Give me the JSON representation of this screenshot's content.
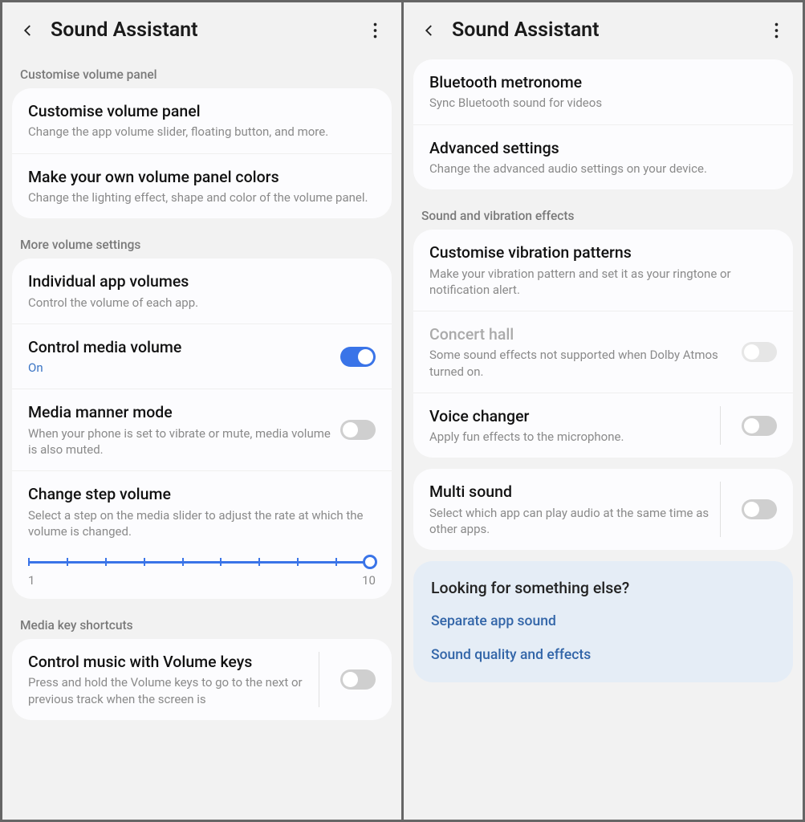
{
  "left": {
    "header": {
      "title": "Sound Assistant"
    },
    "section1": {
      "header": "Customise volume panel",
      "row1": {
        "title": "Customise volume panel",
        "sub": "Change the app volume slider, floating button, and more."
      },
      "row2": {
        "title": "Make your own volume panel colors",
        "sub": "Change the lighting effect, shape and color of the volume panel."
      }
    },
    "section2": {
      "header": "More volume settings",
      "row1": {
        "title": "Individual app volumes",
        "sub": "Control the volume of each app."
      },
      "row2": {
        "title": "Control media volume",
        "sub": "On"
      },
      "row3": {
        "title": "Media manner mode",
        "sub": "When your phone is set to vibrate or mute, media volume is also muted."
      },
      "row4": {
        "title": "Change step volume",
        "sub": "Select a step on the media slider to adjust the rate at which the volume is changed.",
        "min": "1",
        "max": "10"
      }
    },
    "section3": {
      "header": "Media key shortcuts",
      "row1": {
        "title": "Control music with Volume keys",
        "sub": "Press and hold the Volume keys to go to the next or previous track when the screen is"
      }
    }
  },
  "right": {
    "header": {
      "title": "Sound Assistant"
    },
    "section1": {
      "row1": {
        "title": "Bluetooth metronome",
        "sub": "Sync Bluetooth sound for videos"
      },
      "row2": {
        "title": "Advanced settings",
        "sub": "Change the advanced audio settings on your device."
      }
    },
    "section2": {
      "header": "Sound and vibration effects",
      "row1": {
        "title": "Customise vibration patterns",
        "sub": "Make your vibration pattern and set it as your ringtone or notification alert."
      },
      "row2": {
        "title": "Concert hall",
        "sub": "Some sound effects not supported when Dolby Atmos turned on."
      },
      "row3": {
        "title": "Voice changer",
        "sub": "Apply fun effects to the microphone."
      }
    },
    "section3": {
      "row1": {
        "title": "Multi sound",
        "sub": "Select which app can play audio at the same time as other apps."
      }
    },
    "tip": {
      "title": "Looking for something else?",
      "link1": "Separate app sound",
      "link2": "Sound quality and effects"
    }
  }
}
